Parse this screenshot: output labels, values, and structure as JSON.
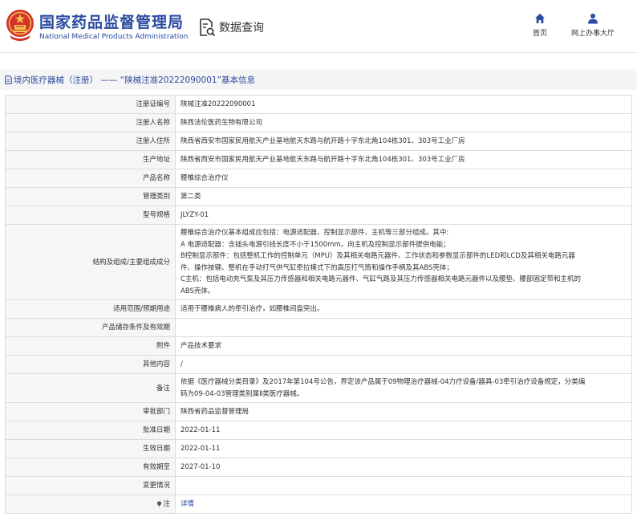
{
  "header": {
    "brand_cn": "国家药品监督管理局",
    "brand_en": "National Medical Products Administration",
    "query_label": "数据查询",
    "nav": [
      {
        "label": "首页",
        "icon": "home-icon"
      },
      {
        "label": "网上办事大厅",
        "icon": "user-icon"
      }
    ],
    "colors": {
      "brand": "#2b4aa0",
      "emblem": "#d3332b",
      "emblem_gold": "#f2c14e"
    }
  },
  "breadcrumb": {
    "icon": "document-icon",
    "text": "境内医疗器械（注册） —— “陕械注准20222090001”基本信息"
  },
  "detail": {
    "rows": [
      {
        "label": "注册证编号",
        "value": "陕械注准20222090001"
      },
      {
        "label": "注册人名称",
        "value": "陕西洁伦医药生物有限公司"
      },
      {
        "label": "注册人住所",
        "value": "陕西省西安市国家民用航天产业基地航天东路与航开路十字东北角104栋301、303号工业厂房"
      },
      {
        "label": "生产地址",
        "value": "陕西省西安市国家民用航天产业基地航天东路与航开路十字东北角104栋301、303号工业厂房"
      },
      {
        "label": "产品名称",
        "value": "腰椎综合治疗仪"
      },
      {
        "label": "管理类别",
        "value": "第二类"
      },
      {
        "label": "型号规格",
        "value": "JLYZY-01"
      },
      {
        "label": "结构及组成/主要组成成分",
        "lines": [
          "腰椎综合治疗仪基本组成应包括：电源适配器、控制显示部件、主机等三部分组成。其中:",
          "A 电源适配器：含插头电源引线长度不小于1500mm。向主机及控制显示部件提供电能；",
          "B控制显示部件：包括整机工作的控制单元（MPU）及其相关电路元器件、工作状态和参数显示部件的LED和LCD及其相关电路元器",
          "件、操作按键、整机在手动打气供气缸牵拉模式下的高压打气筒和操作手柄及其ABS壳体；",
          "C主机：包括电动充气泵及其压力传感器和相关电路元器件、气缸气路及其压力传感器相关电路元器件以及腰垫、腰部固定带和主机的",
          "ABS壳体。"
        ]
      },
      {
        "label": "适用范围/预期用途",
        "value": "适用于腰椎病人的牵引治疗，如腰椎间盘突出。"
      },
      {
        "label": "产品储存条件及有效期",
        "value": ""
      },
      {
        "label": "附件",
        "value": "产品技术要求"
      },
      {
        "label": "其他内容",
        "value": "/"
      },
      {
        "label": "备注",
        "lines": [
          "依据《医疗器械分类目录》及2017年第104号公告，界定该产品属于09物理治疗器械-04力疗设备/器具-03牵引治疗设备规定，分类编",
          "码为09-04-03管理类别属Ⅱ类医疗器械。"
        ]
      },
      {
        "label": "审批部门",
        "value": "陕西省药品监督管理局"
      },
      {
        "label": "批准日期",
        "value": "2022-01-11"
      },
      {
        "label": "生效日期",
        "value": "2022-01-11"
      },
      {
        "label": "有效期至",
        "value": "2027-01-10"
      },
      {
        "label": "变更情况",
        "value": ""
      },
      {
        "label": "注",
        "label_icon": "pin-icon",
        "value": "详情",
        "is_link": true
      }
    ]
  }
}
